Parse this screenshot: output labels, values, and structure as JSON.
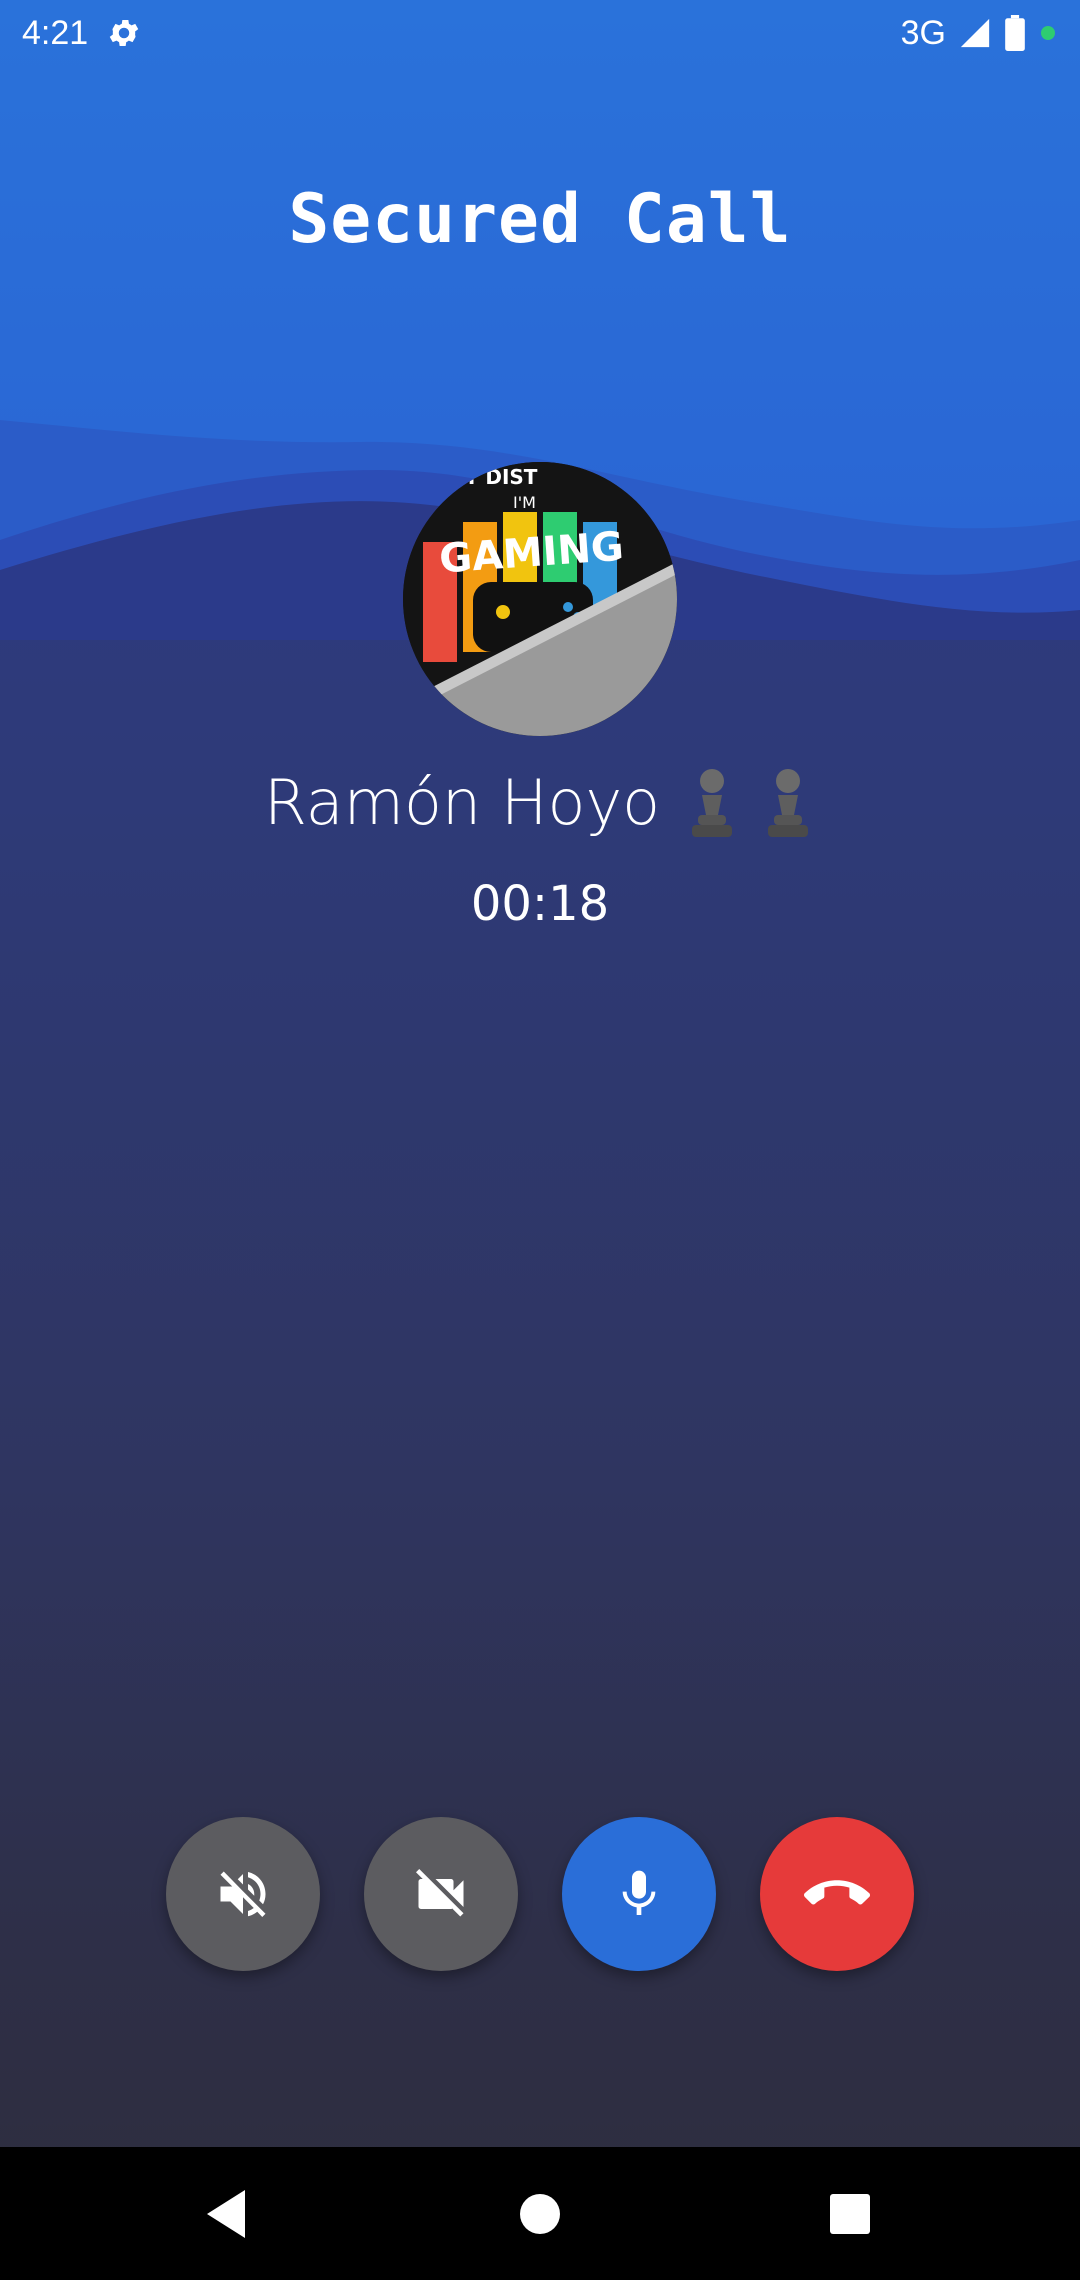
{
  "status_bar": {
    "time": "4:21",
    "network": "3G",
    "icons": [
      "settings-icon",
      "signal-icon",
      "battery-icon",
      "active-dot-icon"
    ]
  },
  "header": {
    "title": "Secured Call"
  },
  "caller": {
    "name": "Ramón Hoyo",
    "emoji": [
      "♟",
      "♟"
    ],
    "avatar_text": [
      "NOT DIST",
      "I'M",
      "GAMING"
    ]
  },
  "call": {
    "duration": "00:18"
  },
  "controls": [
    {
      "name": "speaker-off-button",
      "icon": "volume-off-icon",
      "color": "#5c5c60"
    },
    {
      "name": "video-off-button",
      "icon": "videocam-off-icon",
      "color": "#5c5c60"
    },
    {
      "name": "microphone-button",
      "icon": "mic-icon",
      "color": "#2a6ed8"
    },
    {
      "name": "end-call-button",
      "icon": "call-end-icon",
      "color": "#e63a3a"
    }
  ],
  "navigation": {
    "buttons": [
      "back-icon",
      "home-icon",
      "recents-icon"
    ]
  },
  "colors": {
    "header_blue": "#2a6ed8",
    "end_call_red": "#e63a3a",
    "background_dark": "#2d2d3c",
    "active_dot": "#2ecc71"
  }
}
